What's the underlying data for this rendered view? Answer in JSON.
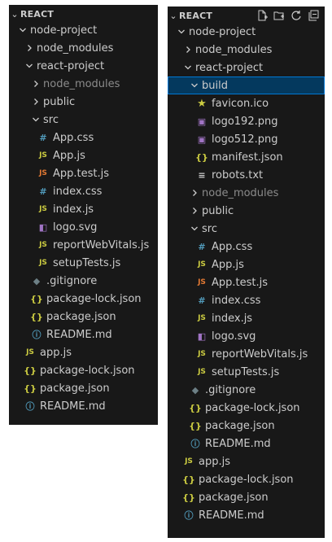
{
  "explorer_left": {
    "section_title": "REACT",
    "tree": [
      {
        "label": "node-project",
        "type": "folder",
        "open": true,
        "depth": 0
      },
      {
        "label": "node_modules",
        "type": "folder",
        "open": false,
        "depth": 1
      },
      {
        "label": "react-project",
        "type": "folder",
        "open": true,
        "depth": 1
      },
      {
        "label": "node_modules",
        "type": "folder",
        "open": false,
        "depth": 2,
        "dim": true
      },
      {
        "label": "public",
        "type": "folder",
        "open": false,
        "depth": 2
      },
      {
        "label": "src",
        "type": "folder",
        "open": true,
        "depth": 2
      },
      {
        "label": "App.css",
        "type": "css",
        "depth": 3
      },
      {
        "label": "App.js",
        "type": "js",
        "depth": 3
      },
      {
        "label": "App.test.js",
        "type": "test",
        "depth": 3
      },
      {
        "label": "index.css",
        "type": "css",
        "depth": 3
      },
      {
        "label": "index.js",
        "type": "js",
        "depth": 3
      },
      {
        "label": "logo.svg",
        "type": "svg",
        "depth": 3
      },
      {
        "label": "reportWebVitals.js",
        "type": "js",
        "depth": 3
      },
      {
        "label": "setupTests.js",
        "type": "js",
        "depth": 3
      },
      {
        "label": ".gitignore",
        "type": "git",
        "depth": 2
      },
      {
        "label": "package-lock.json",
        "type": "json",
        "depth": 2
      },
      {
        "label": "package.json",
        "type": "json",
        "depth": 2
      },
      {
        "label": "README.md",
        "type": "info",
        "depth": 2
      },
      {
        "label": "app.js",
        "type": "js",
        "depth": 1
      },
      {
        "label": "package-lock.json",
        "type": "json",
        "depth": 1
      },
      {
        "label": "package.json",
        "type": "json",
        "depth": 1
      },
      {
        "label": "README.md",
        "type": "info",
        "depth": 1
      }
    ]
  },
  "explorer_right": {
    "section_title": "REACT",
    "tree": [
      {
        "label": "node-project",
        "type": "folder",
        "open": true,
        "depth": 0
      },
      {
        "label": "node_modules",
        "type": "folder",
        "open": false,
        "depth": 1
      },
      {
        "label": "react-project",
        "type": "folder",
        "open": true,
        "depth": 1
      },
      {
        "label": "build",
        "type": "folder",
        "open": true,
        "depth": 2,
        "selected": true
      },
      {
        "label": "favicon.ico",
        "type": "star",
        "depth": 3
      },
      {
        "label": "logo192.png",
        "type": "image",
        "depth": 3
      },
      {
        "label": "logo512.png",
        "type": "image",
        "depth": 3
      },
      {
        "label": "manifest.json",
        "type": "json",
        "depth": 3
      },
      {
        "label": "robots.txt",
        "type": "text",
        "depth": 3
      },
      {
        "label": "node_modules",
        "type": "folder",
        "open": false,
        "depth": 2,
        "dim": true
      },
      {
        "label": "public",
        "type": "folder",
        "open": false,
        "depth": 2
      },
      {
        "label": "src",
        "type": "folder",
        "open": true,
        "depth": 2
      },
      {
        "label": "App.css",
        "type": "css",
        "depth": 3
      },
      {
        "label": "App.js",
        "type": "js",
        "depth": 3
      },
      {
        "label": "App.test.js",
        "type": "test",
        "depth": 3
      },
      {
        "label": "index.css",
        "type": "css",
        "depth": 3
      },
      {
        "label": "index.js",
        "type": "js",
        "depth": 3
      },
      {
        "label": "logo.svg",
        "type": "svg",
        "depth": 3
      },
      {
        "label": "reportWebVitals.js",
        "type": "js",
        "depth": 3
      },
      {
        "label": "setupTests.js",
        "type": "js",
        "depth": 3
      },
      {
        "label": ".gitignore",
        "type": "git",
        "depth": 2
      },
      {
        "label": "package-lock.json",
        "type": "json",
        "depth": 2
      },
      {
        "label": "package.json",
        "type": "json",
        "depth": 2
      },
      {
        "label": "README.md",
        "type": "info",
        "depth": 2
      },
      {
        "label": "app.js",
        "type": "js",
        "depth": 1
      },
      {
        "label": "package-lock.json",
        "type": "json",
        "depth": 1
      },
      {
        "label": "package.json",
        "type": "json",
        "depth": 1
      },
      {
        "label": "README.md",
        "type": "info",
        "depth": 1
      }
    ],
    "header_actions": [
      "new-file-icon",
      "new-folder-icon",
      "refresh-icon",
      "collapse-all-icon"
    ]
  },
  "icon_colors": {
    "css": "#519aba",
    "js": "#cbcb41",
    "test": "#e37933",
    "json": "#cbcb41",
    "svg": "#a074c4",
    "git": "#6d8086",
    "info": "#519aba",
    "star": "#cbcb41",
    "image": "#a074c4",
    "text": "#cccccc"
  },
  "icon_glyphs": {
    "css": "#",
    "js": "JS",
    "test": "JS",
    "json": "{}",
    "svg": "◧",
    "git": "◆",
    "info": "ⓘ",
    "star": "★",
    "image": "▣",
    "text": "≡"
  }
}
